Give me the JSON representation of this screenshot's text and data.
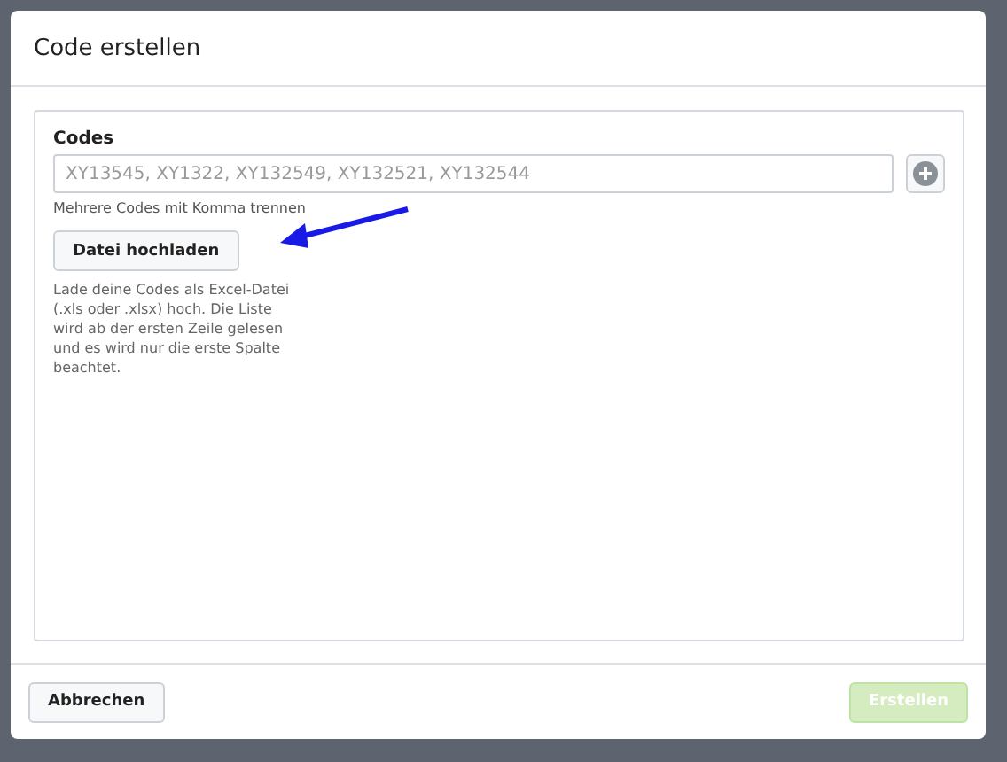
{
  "dialog": {
    "title": "Code erstellen"
  },
  "codes": {
    "label": "Codes",
    "placeholder": "XY13545, XY1322, XY132549, XY132521, XY132544",
    "hint": "Mehrere Codes mit Komma trennen"
  },
  "upload": {
    "button": "Datei hochladen",
    "help": "Lade deine Codes als Excel-Datei (.xls oder .xlsx) hoch. Die Liste wird ab der ersten Zeile gelesen und es wird nur die erste Spalte beachtet."
  },
  "footer": {
    "cancel": "Abbrechen",
    "submit": {
      "label": "Erstellen",
      "disabled": true
    }
  }
}
